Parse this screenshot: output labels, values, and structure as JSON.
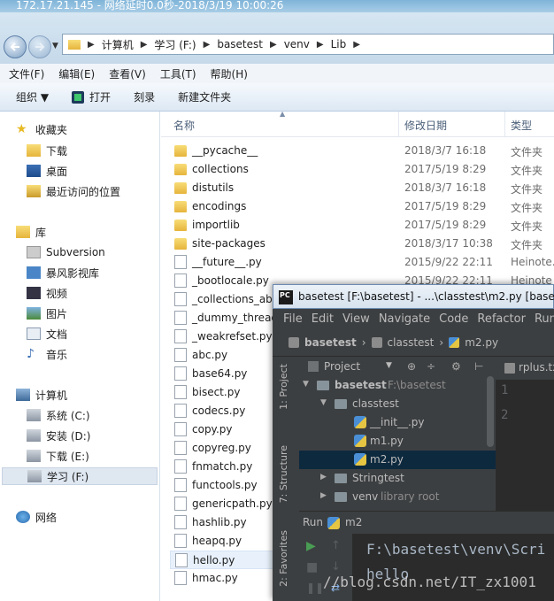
{
  "window_title": "172.17.21.145 - 网络延时0.0秒-2018/3/19 10:00:26",
  "address": {
    "crumbs": [
      "计算机",
      "学习 (F:)",
      "basetest",
      "venv",
      "Lib"
    ]
  },
  "menu": [
    "文件(F)",
    "编辑(E)",
    "查看(V)",
    "工具(T)",
    "帮助(H)"
  ],
  "toolbar": {
    "organize": "组织 ▼",
    "open": "打开",
    "burn": "刻录",
    "new_folder": "新建文件夹"
  },
  "nav": {
    "favorites": "收藏夹",
    "downloads": "下载",
    "desktop": "桌面",
    "recent": "最近访问的位置",
    "library": "库",
    "subversion": "Subversion",
    "storm": "暴风影视库",
    "video": "视频",
    "pictures": "图片",
    "documents": "文档",
    "music": "音乐",
    "computer": "计算机",
    "drive_c": "系统 (C:)",
    "drive_d": "安装 (D:)",
    "drive_e": "下载 (E:)",
    "drive_f": "学习 (F:)",
    "network": "网络"
  },
  "columns": {
    "name": "名称",
    "date": "修改日期",
    "type": "类型"
  },
  "files": [
    {
      "name": "__pycache__",
      "date": "2018/3/7 16:18",
      "type": "文件夹",
      "kind": "folder"
    },
    {
      "name": "collections",
      "date": "2017/5/19 8:29",
      "type": "文件夹",
      "kind": "folder"
    },
    {
      "name": "distutils",
      "date": "2018/3/7 16:18",
      "type": "文件夹",
      "kind": "folder"
    },
    {
      "name": "encodings",
      "date": "2017/5/19 8:29",
      "type": "文件夹",
      "kind": "folder"
    },
    {
      "name": "importlib",
      "date": "2017/5/19 8:29",
      "type": "文件夹",
      "kind": "folder"
    },
    {
      "name": "site-packages",
      "date": "2018/3/17 10:38",
      "type": "文件夹",
      "kind": "folder"
    },
    {
      "name": "__future__.py",
      "date": "2015/9/22 22:11",
      "type": "Heinote.",
      "kind": "file"
    },
    {
      "name": "_bootlocale.py",
      "date": "2015/9/22 22:11",
      "type": "Heinote",
      "kind": "file"
    },
    {
      "name": "_collections_abc",
      "date": "",
      "type": "",
      "kind": "file"
    },
    {
      "name": "_dummy_thread",
      "date": "",
      "type": "",
      "kind": "file"
    },
    {
      "name": "_weakrefset.py",
      "date": "",
      "type": "",
      "kind": "file"
    },
    {
      "name": "abc.py",
      "date": "",
      "type": "",
      "kind": "file"
    },
    {
      "name": "base64.py",
      "date": "",
      "type": "",
      "kind": "file"
    },
    {
      "name": "bisect.py",
      "date": "",
      "type": "",
      "kind": "file"
    },
    {
      "name": "codecs.py",
      "date": "",
      "type": "",
      "kind": "file"
    },
    {
      "name": "copy.py",
      "date": "",
      "type": "",
      "kind": "file"
    },
    {
      "name": "copyreg.py",
      "date": "",
      "type": "",
      "kind": "file"
    },
    {
      "name": "fnmatch.py",
      "date": "",
      "type": "",
      "kind": "file"
    },
    {
      "name": "functools.py",
      "date": "",
      "type": "",
      "kind": "file"
    },
    {
      "name": "genericpath.py",
      "date": "",
      "type": "",
      "kind": "file"
    },
    {
      "name": "hashlib.py",
      "date": "",
      "type": "",
      "kind": "file"
    },
    {
      "name": "heapq.py",
      "date": "",
      "type": "",
      "kind": "file"
    },
    {
      "name": "hello.py",
      "date": "",
      "type": "",
      "kind": "file"
    },
    {
      "name": "hmac.py",
      "date": "",
      "type": "",
      "kind": "file"
    }
  ],
  "pycharm": {
    "title": "basetest [F:\\basetest] - ...\\classtest\\m2.py [basetes",
    "menu": [
      "File",
      "Edit",
      "View",
      "Navigate",
      "Code",
      "Refactor",
      "Run"
    ],
    "breadcrumb": [
      "basetest",
      "classtest",
      "m2.py"
    ],
    "side_tabs": [
      "1: Project",
      "7: Structure",
      "2: Favorites"
    ],
    "project_label": "Project",
    "tree": {
      "root": "basetest",
      "root_path": "F:\\basetest",
      "classtest": "classtest",
      "init": "__init__.py",
      "m1": "m1.py",
      "m2": "m2.py",
      "stringtest": "Stringtest",
      "venv": "venv",
      "venv_note": "library root"
    },
    "editor_tab": "rplus.tx",
    "line_numbers": [
      "1",
      "2"
    ],
    "run_label": "Run",
    "run_config": "m2",
    "console": [
      "F:\\basetest\\venv\\Scri",
      "hello"
    ]
  },
  "watermark": "//blog.csdn.net/IT_zx1001"
}
